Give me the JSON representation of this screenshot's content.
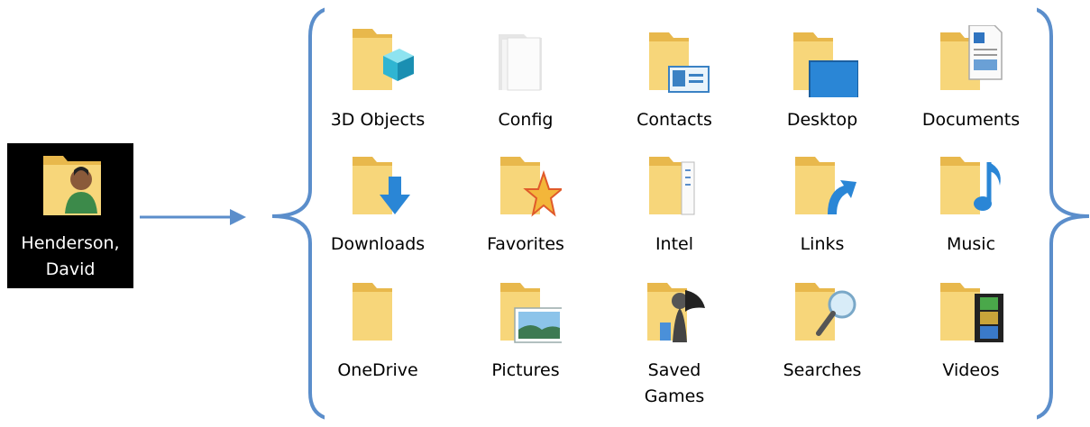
{
  "user": {
    "name_line1": "Henderson,",
    "name_line2": "David",
    "icon": "user-folder-icon"
  },
  "folders": [
    {
      "id": "3d-objects",
      "label": "3D Objects",
      "icon": "cube-folder-icon"
    },
    {
      "id": "config",
      "label": "Config",
      "icon": "config-folder-icon"
    },
    {
      "id": "contacts",
      "label": "Contacts",
      "icon": "contact-card-folder-icon"
    },
    {
      "id": "desktop",
      "label": "Desktop",
      "icon": "desktop-folder-icon"
    },
    {
      "id": "documents",
      "label": "Documents",
      "icon": "document-folder-icon"
    },
    {
      "id": "downloads",
      "label": "Downloads",
      "icon": "download-arrow-folder-icon"
    },
    {
      "id": "favorites",
      "label": "Favorites",
      "icon": "star-folder-icon"
    },
    {
      "id": "intel",
      "label": "Intel",
      "icon": "intel-folder-icon"
    },
    {
      "id": "links",
      "label": "Links",
      "icon": "shortcut-arrow-folder-icon"
    },
    {
      "id": "music",
      "label": "Music",
      "icon": "music-note-folder-icon"
    },
    {
      "id": "onedrive",
      "label": "OneDrive",
      "icon": "plain-folder-icon"
    },
    {
      "id": "pictures",
      "label": "Pictures",
      "icon": "picture-folder-icon"
    },
    {
      "id": "saved-games",
      "label": "Saved Games",
      "label_line1": "Saved",
      "label_line2": "Games",
      "icon": "chess-pawn-folder-icon"
    },
    {
      "id": "searches",
      "label": "Searches",
      "icon": "magnifier-folder-icon"
    },
    {
      "id": "videos",
      "label": "Videos",
      "icon": "film-folder-icon"
    }
  ],
  "colors": {
    "connector_blue": "#5b8ecb",
    "folder_yellow": "#f7d67a",
    "folder_back": "#e8b84c",
    "user_tile_bg": "#000000"
  }
}
